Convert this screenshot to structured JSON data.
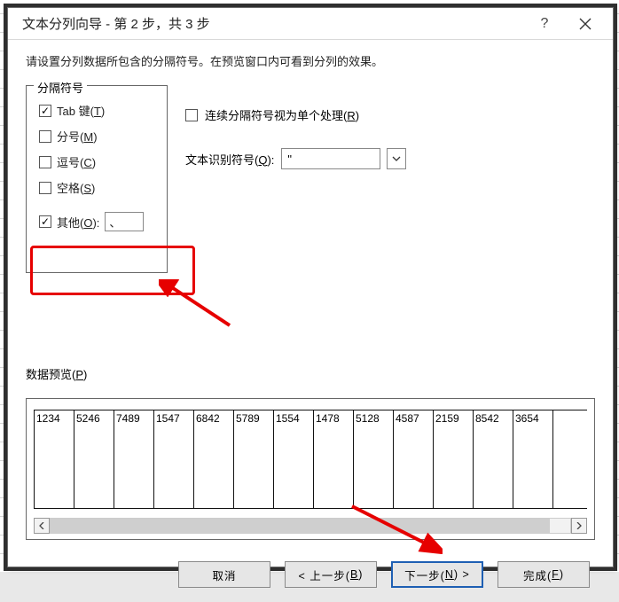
{
  "dialog": {
    "title": "文本分列向导 - 第 2 步，共 3 步",
    "help": "?",
    "instruction": "请设置分列数据所包含的分隔符号。在预览窗口内可看到分列的效果。"
  },
  "delimiters": {
    "legend": "分隔符号",
    "tab": "Tab 键(T)",
    "semicolon": "分号(M)",
    "comma": "逗号(C)",
    "space": "空格(S)",
    "other": "其他(O):",
    "other_value": "、",
    "checked": {
      "tab": true,
      "semicolon": false,
      "comma": false,
      "space": false,
      "other": true
    }
  },
  "right": {
    "consecutive": "连续分隔符号视为单个处理(R)",
    "text_qualifier_label": "文本识别符号(Q):",
    "text_qualifier_value": "\""
  },
  "preview": {
    "label": "数据预览(P)",
    "values": [
      "1234",
      "5246",
      "7489",
      "1547",
      "6842",
      "5789",
      "1554",
      "1478",
      "5128",
      "4587",
      "2159",
      "8542",
      "3654"
    ]
  },
  "buttons": {
    "cancel": "取消",
    "back": "< 上一步(B)",
    "next": "下一步(N) >",
    "finish": "完成(F)"
  }
}
